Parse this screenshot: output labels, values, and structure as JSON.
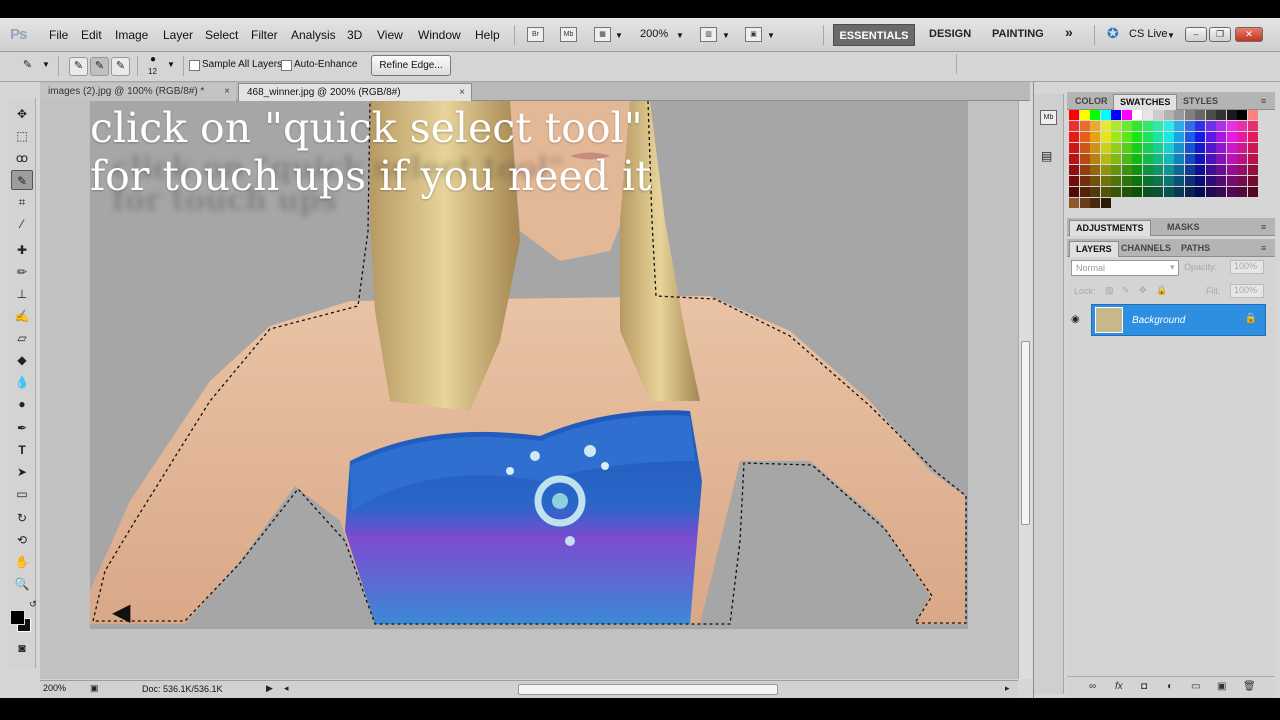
{
  "menubar": {
    "logo": "Ps",
    "items": [
      "File",
      "Edit",
      "Image",
      "Layer",
      "Select",
      "Filter",
      "Analysis",
      "3D",
      "View",
      "Window",
      "Help"
    ],
    "bridge_label": "Br",
    "minibridge_label": "Mb",
    "zoom_value": "200%",
    "workspaces": [
      "ESSENTIALS",
      "DESIGN",
      "PAINTING"
    ],
    "more_workspaces": "»",
    "cs_live": "CS Live"
  },
  "options": {
    "brush_size": "12",
    "sample_all_layers": "Sample All Layers",
    "auto_enhance": "Auto-Enhance",
    "refine_edge": "Refine Edge..."
  },
  "document_tabs": [
    {
      "title": "images (2).jpg @ 100% (RGB/8#) *",
      "close": "×"
    },
    {
      "title": "468_winner.jpg @ 200% (RGB/8#)",
      "close": "×"
    }
  ],
  "canvas": {
    "overlay_line1": "click on \"quick select tool\"",
    "overlay_line2": "for touch ups if you need it"
  },
  "status": {
    "zoom": "200%",
    "doc": "Doc: 536.1K/536.1K"
  },
  "panels": {
    "top_tabs": [
      "COLOR",
      "SWATCHES",
      "STYLES"
    ],
    "mid_tabs": [
      "ADJUSTMENTS",
      "MASKS"
    ],
    "layer_tabs": [
      "LAYERS",
      "CHANNELS",
      "PATHS"
    ],
    "blend_mode": "Normal",
    "opacity_label": "Opacity:",
    "opacity_value": "100%",
    "lock_label": "Lock:",
    "fill_label": "Fill:",
    "fill_value": "100%",
    "layer_name": "Background"
  }
}
